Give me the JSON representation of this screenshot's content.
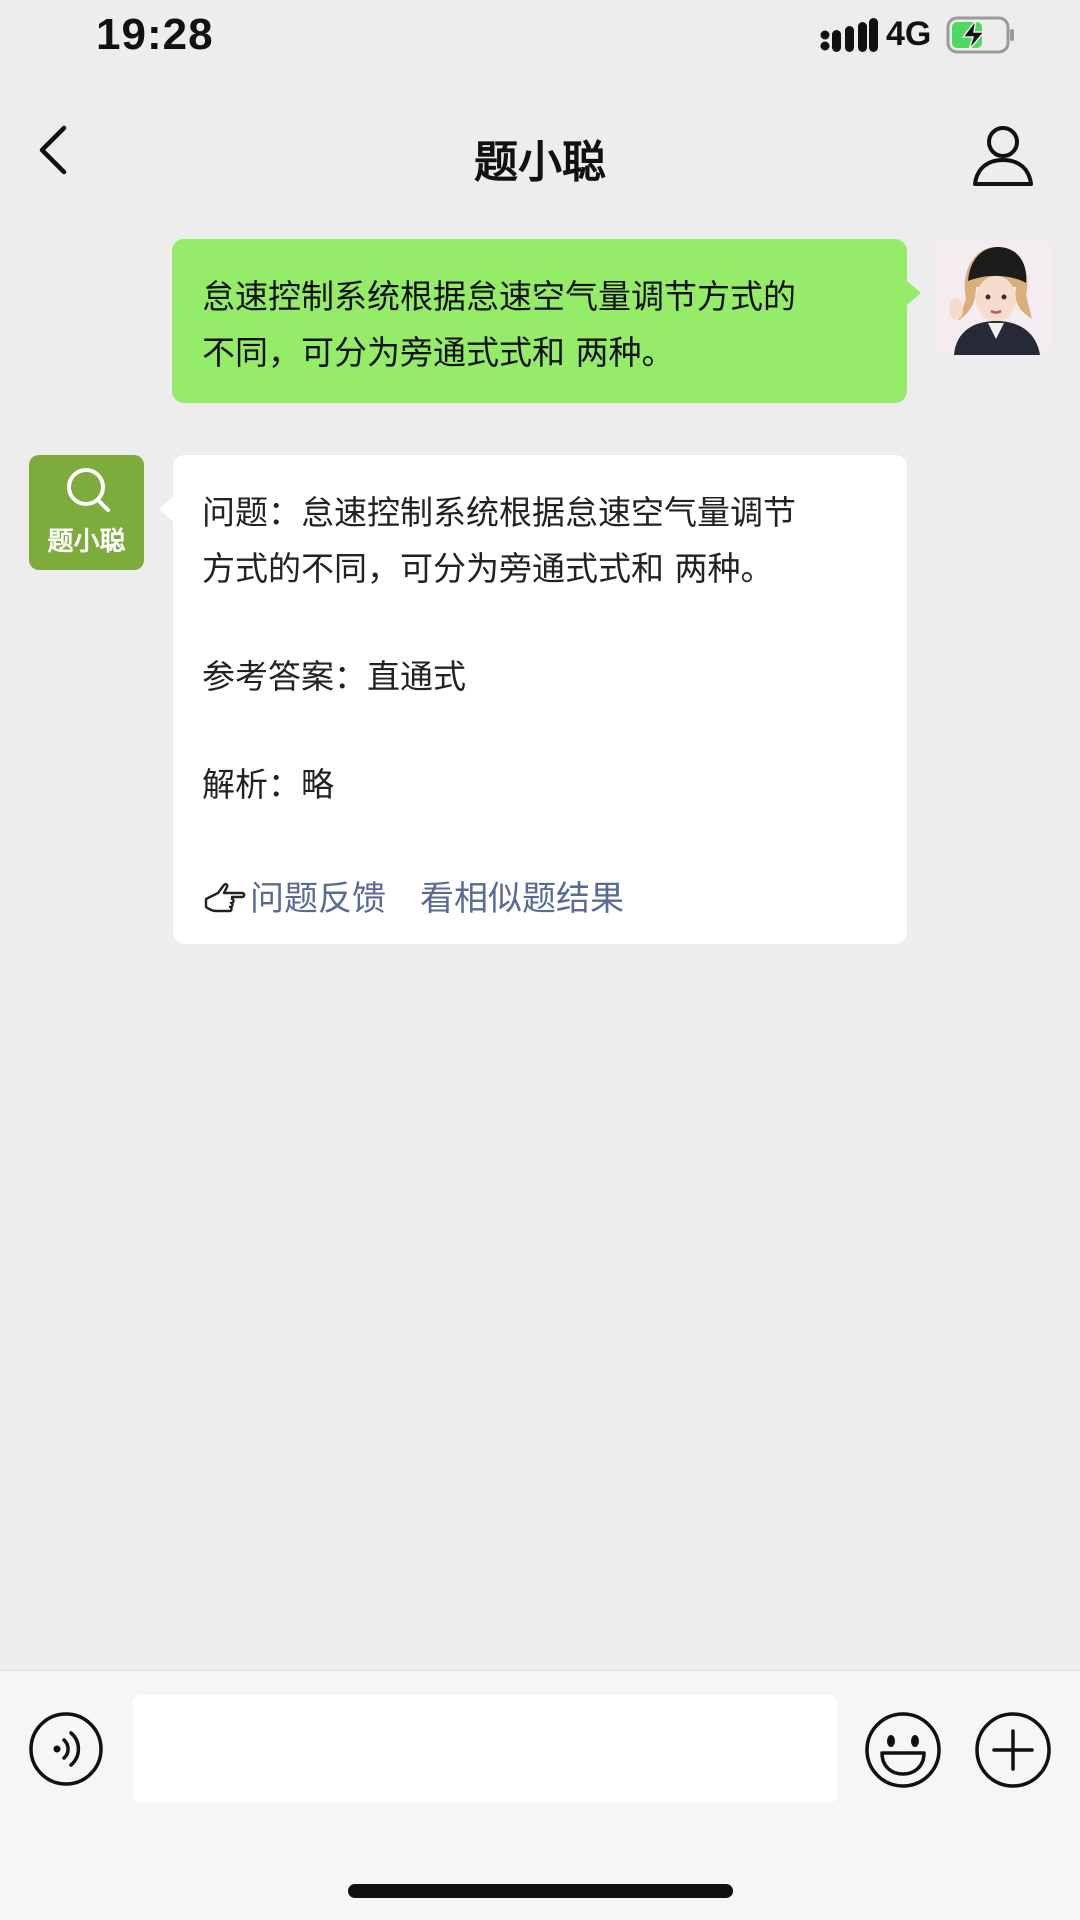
{
  "status_bar": {
    "time": "19:28",
    "network": "4G",
    "icons": [
      "signal-icon",
      "battery-charging-icon"
    ]
  },
  "nav": {
    "title": "题小聪",
    "icons": [
      "back-chevron-icon",
      "profile-icon"
    ]
  },
  "messages": {
    "user": {
      "text_line1": "怠速控制系统根据怠速空气量调节方式的",
      "text_line2": "不同，可分为旁通式式和 两种。"
    },
    "bot": {
      "avatar_label": "题小聪",
      "question_line1": "问题：怠速控制系统根据怠速空气量调节",
      "question_line2": "方式的不同，可分为旁通式式和 两种。",
      "answer": "参考答案：直通式",
      "analysis": "解析：略",
      "feedback_link": "问题反馈",
      "similar_link": "看相似题结果"
    }
  },
  "input_bar": {
    "input_value": "",
    "icons": [
      "voice-icon",
      "emoji-icon",
      "plus-icon"
    ]
  },
  "colors": {
    "background": "#ededed",
    "user_bubble": "#95ec69",
    "bot_bubble": "#ffffff",
    "link": "#576b95",
    "bot_avatar": "#7dac3c"
  }
}
